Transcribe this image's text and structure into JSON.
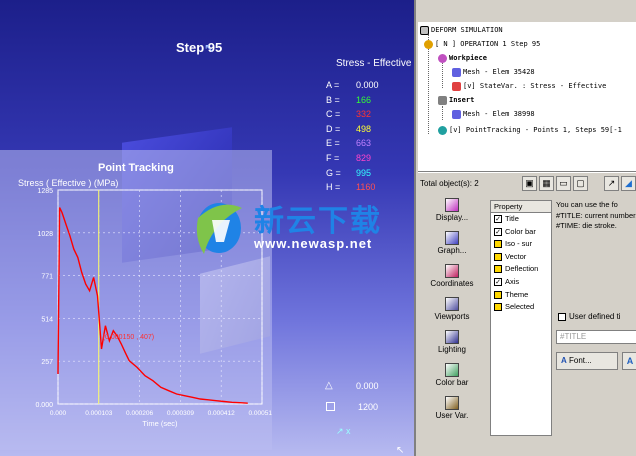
{
  "viewport": {
    "step_label": "Step 95",
    "legend_title": "Stress - Effective",
    "legend": [
      {
        "key": "A =",
        "value": "0.000",
        "color": "#ffffff"
      },
      {
        "key": "B =",
        "value": "166",
        "color": "#33ff33"
      },
      {
        "key": "C =",
        "value": "332",
        "color": "#ff3333"
      },
      {
        "key": "D =",
        "value": "498",
        "color": "#ffff33"
      },
      {
        "key": "E =",
        "value": "663",
        "color": "#c080ff"
      },
      {
        "key": "F =",
        "value": "829",
        "color": "#ff44cc"
      },
      {
        "key": "G =",
        "value": "995",
        "color": "#33ffff"
      },
      {
        "key": "H =",
        "value": "1160",
        "color": "#ff5050"
      }
    ],
    "bottom_values": [
      "0.000",
      "1200"
    ]
  },
  "point_tracking": {
    "title": "Point Tracking",
    "ylabel": "Stress ( Effective ) (MPa)",
    "xlabel": "Time (sec)",
    "annotation": "(0.000150 , 407)"
  },
  "chart_data": {
    "type": "line",
    "title": "Point Tracking",
    "xlabel": "Time (sec)",
    "ylabel": "Stress ( Effective ) (MPa)",
    "x_ticks": [
      "0.000",
      "0.000103",
      "0.000206",
      "0.000309",
      "0.000412",
      "0.000516"
    ],
    "y_ticks": [
      "0.000",
      "257",
      "514",
      "771",
      "1028",
      "1285"
    ],
    "xlim": [
      0,
      0.000516
    ],
    "ylim": [
      0,
      1285
    ],
    "grid": true,
    "series": [
      {
        "color": "#ff0000",
        "x": [
          0.0,
          4e-06,
          1e-05,
          2e-05,
          3e-05,
          4e-05,
          5e-05,
          6e-05,
          7e-05,
          8e-05,
          9e-05,
          0.0001,
          0.00011,
          0.00012,
          0.00013,
          0.00014,
          0.00015,
          0.00016,
          0.00017,
          0.00018,
          0.0002,
          0.00022,
          0.00024,
          0.00026,
          0.00028,
          0.0003,
          0.00032,
          0.00034,
          0.00036,
          0.00038,
          0.0004,
          0.00042,
          0.00044,
          0.00046,
          0.00048
        ],
        "y": [
          180,
          1180,
          1150,
          1080,
          1010,
          930,
          880,
          790,
          720,
          680,
          760,
          650,
          330,
          470,
          380,
          440,
          407,
          360,
          310,
          260,
          220,
          170,
          140,
          100,
          80,
          60,
          50,
          40,
          30,
          25,
          20,
          15,
          10,
          8,
          5
        ]
      }
    ],
    "marker_x": 0.000103
  },
  "tree": {
    "root": "DEFORM SIMULATION",
    "operation": "[ N ]  OPERATION 1   Step 95",
    "workpiece": "Workpiece",
    "wp_mesh": "Mesh - Elem 35428",
    "wp_statevar": "[v] StateVar. :  Stress - Effective",
    "insert": "Insert",
    "ins_mesh": "Mesh - Elem 38998",
    "tracking": "[v] PointTracking - Points 1, Steps 59[-1"
  },
  "status": {
    "total_objects": "Total object(s): 2"
  },
  "tools": [
    "Display...",
    "Graph...",
    "Coordinates",
    "Viewports",
    "Lighting",
    "Color bar",
    "User Var."
  ],
  "property": {
    "header": "Property",
    "items": [
      {
        "label": "Title",
        "checked": true
      },
      {
        "label": "Color bar",
        "checked": true
      },
      {
        "label": "Iso - sur",
        "checked": false
      },
      {
        "label": "Vector",
        "checked": false
      },
      {
        "label": "Deflection",
        "checked": false
      },
      {
        "label": "Axis",
        "checked": true
      },
      {
        "label": "Theme",
        "checked": false
      },
      {
        "label": "Selected",
        "checked": false
      }
    ]
  },
  "description": "You can use the fo #TITLE: current number, #TIME: die stroke.",
  "user_defined_label": "User defined ti",
  "title_input_placeholder": "#TITLE",
  "font_button": "Font...",
  "watermark": {
    "logo_text": "新云下载",
    "url": "www.newasp.net"
  }
}
